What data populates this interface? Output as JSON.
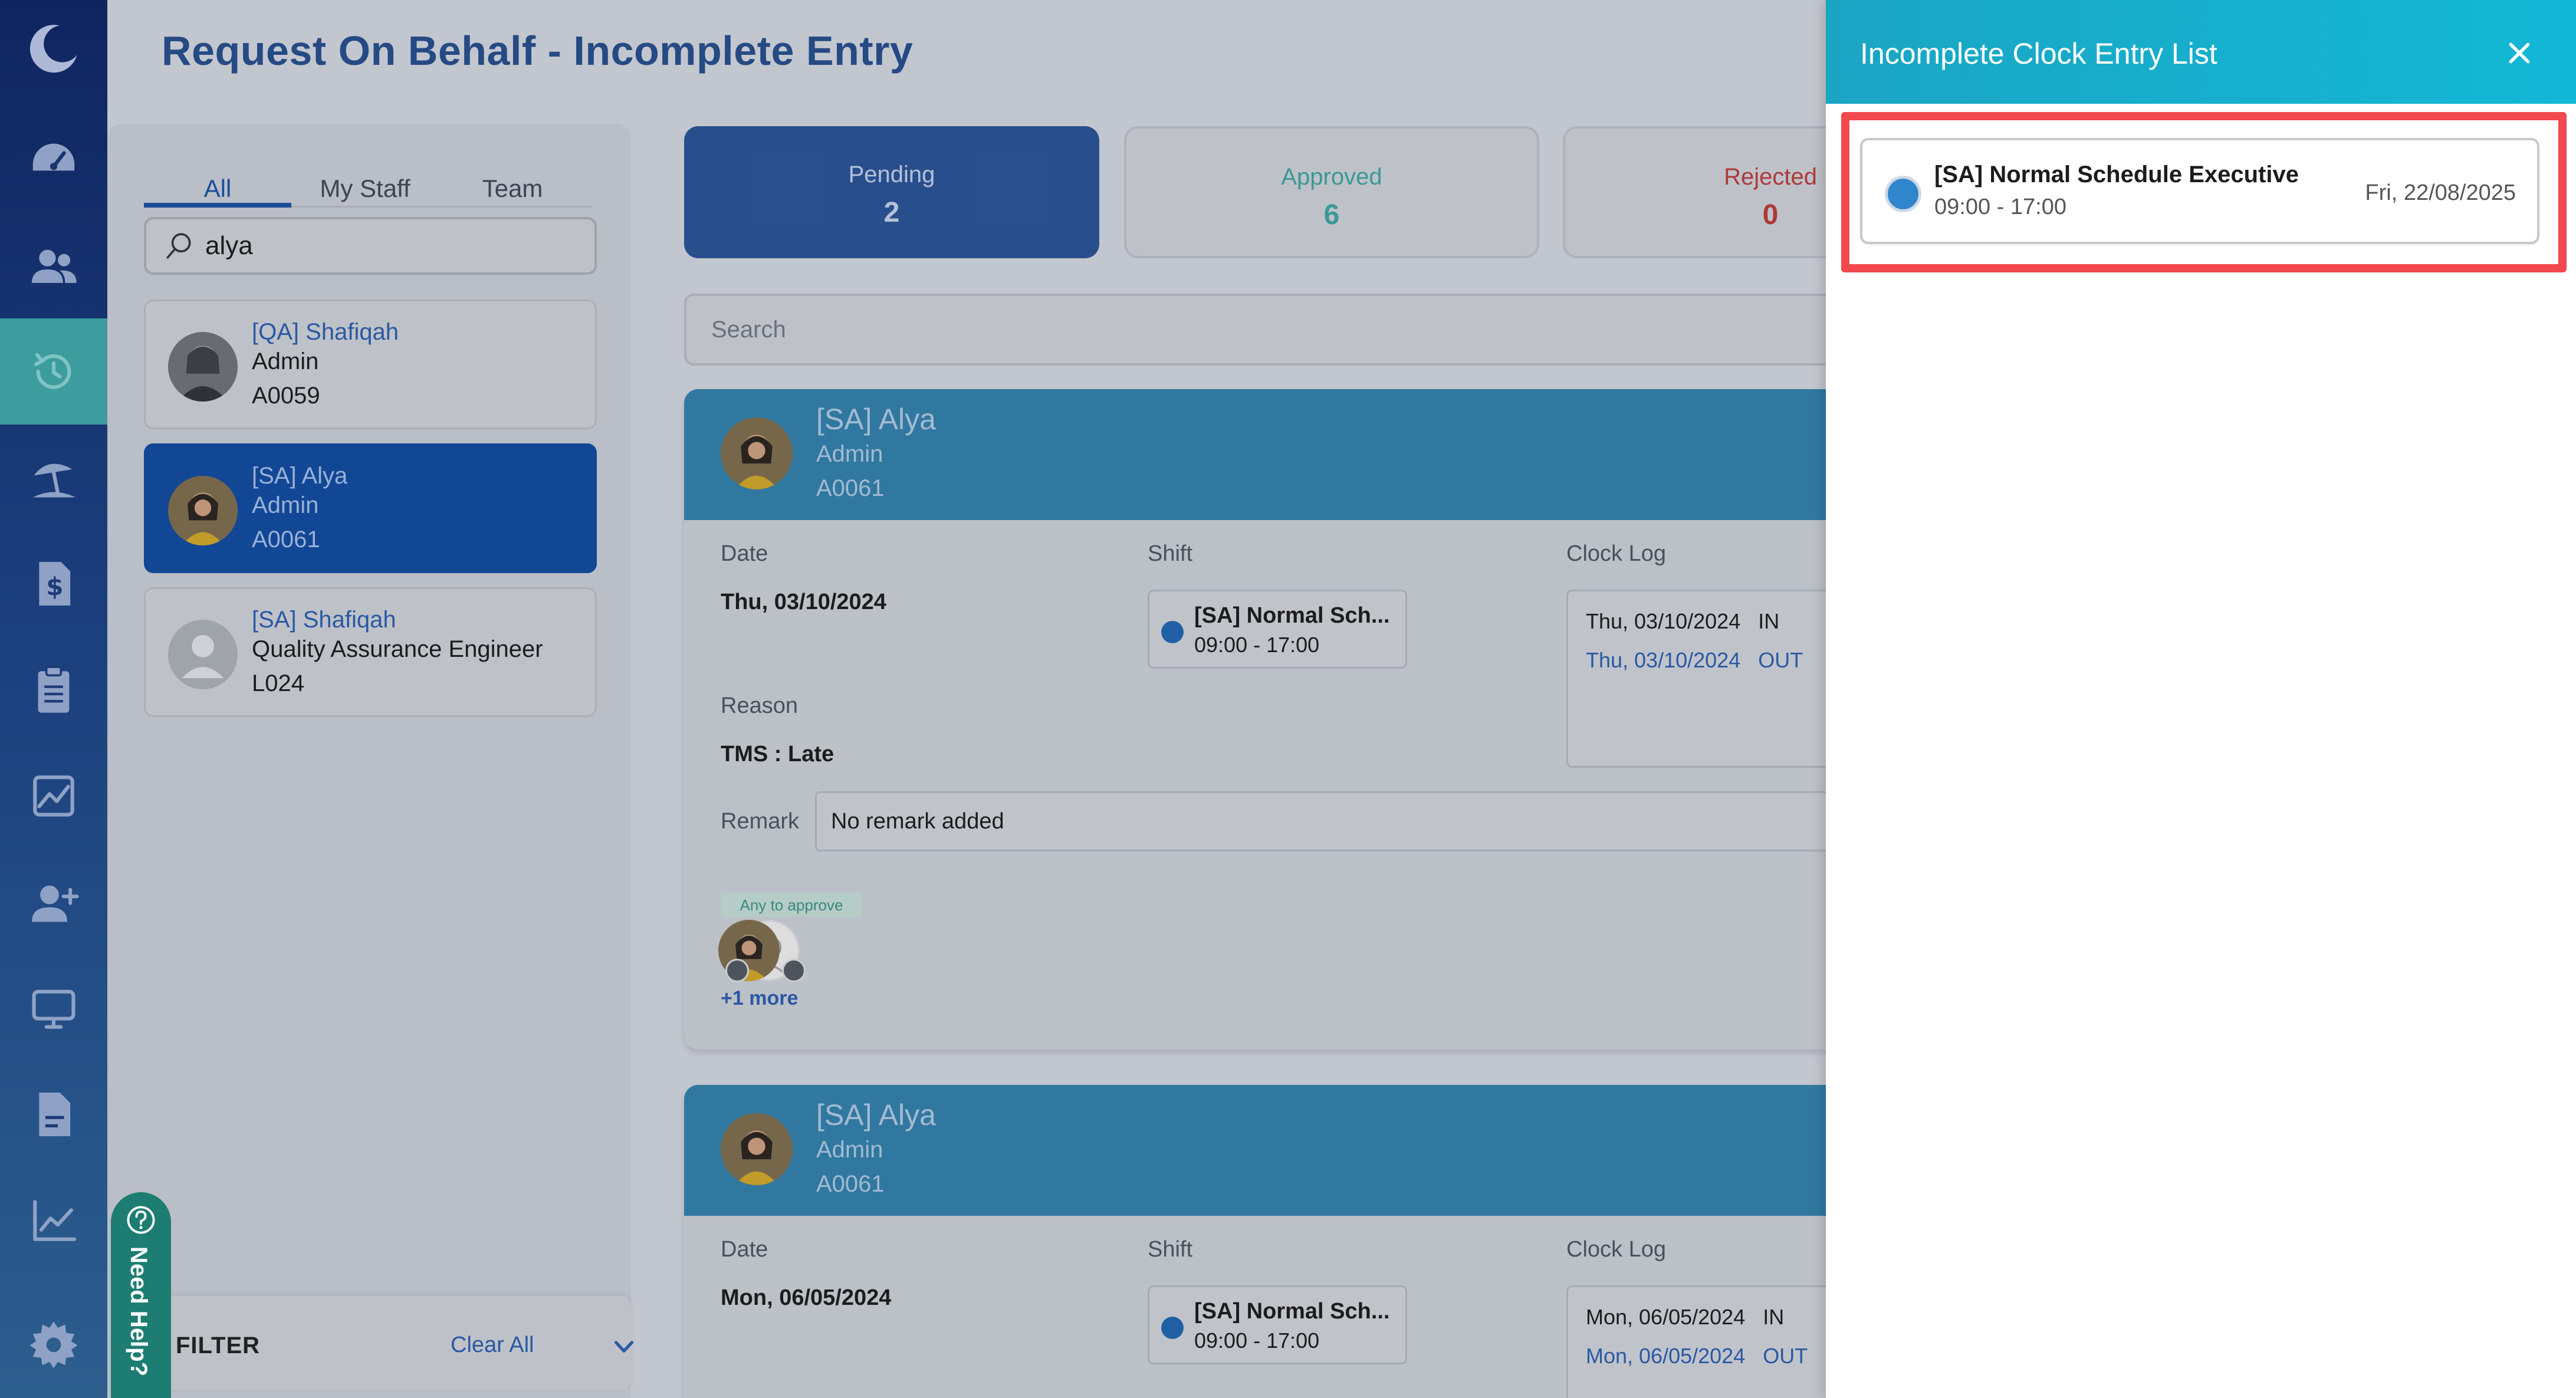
{
  "page": {
    "title": "Request On Behalf - Incomplete Entry"
  },
  "staff_panel": {
    "tabs": [
      {
        "label": "All"
      },
      {
        "label": "My Staff"
      },
      {
        "label": "Team"
      }
    ],
    "search_value": "alya",
    "staff": [
      {
        "name": "[QA] Shafiqah",
        "role": "Admin",
        "code": "A0059"
      },
      {
        "name": "[SA] Alya",
        "role": "Admin",
        "code": "A0061"
      },
      {
        "name": "[SA] Shafiqah",
        "role": "Quality Assurance Engineer",
        "code": "L024"
      }
    ],
    "filter_label": "FILTER",
    "clear_all_label": "Clear All"
  },
  "need_help_label": "Need Help?",
  "status_tiles": {
    "pending": {
      "label": "Pending",
      "count": "2"
    },
    "approved": {
      "label": "Approved",
      "count": "6"
    },
    "rejected": {
      "label": "Rejected",
      "count": "0"
    }
  },
  "requests_search_placeholder": "Search",
  "labels": {
    "date": "Date",
    "shift": "Shift",
    "clock_log": "Clock Log",
    "reason": "Reason",
    "remark": "Remark",
    "any_to_approve": "Any to approve",
    "more": "+1 more",
    "in": "IN",
    "out": "OUT"
  },
  "requests": [
    {
      "name": "[SA] Alya",
      "role": "Admin",
      "code": "A0061",
      "date": "Thu, 03/10/2024",
      "shift_name": "[SA] Normal Sch...",
      "shift_time": "09:00 - 17:00",
      "clock_in": "Thu, 03/10/2024",
      "clock_out": "Thu, 03/10/2024",
      "reason": "TMS : Late",
      "remark": "No remark added"
    },
    {
      "name": "[SA] Alya",
      "role": "Admin",
      "code": "A0061",
      "date": "Mon, 06/05/2024",
      "shift_name": "[SA] Normal Sch...",
      "shift_time": "09:00 - 17:00",
      "clock_in": "Mon, 06/05/2024",
      "clock_out": "Mon, 06/05/2024"
    }
  ],
  "drawer": {
    "title": "Incomplete Clock Entry List",
    "entries": [
      {
        "shift_name": "[SA] Normal Schedule Executive",
        "shift_time": "09:00 - 17:00",
        "date": "Fri, 22/08/2025"
      }
    ]
  },
  "colors": {
    "brand_blue": "#254b87",
    "sidebar_active": "#3d9c9e",
    "pending_tile": "#29508f",
    "card_header": "#317ba4",
    "drawer_header": "#13b8d6",
    "highlight": "#f1484e",
    "shift_dot": "#2f86cc"
  }
}
